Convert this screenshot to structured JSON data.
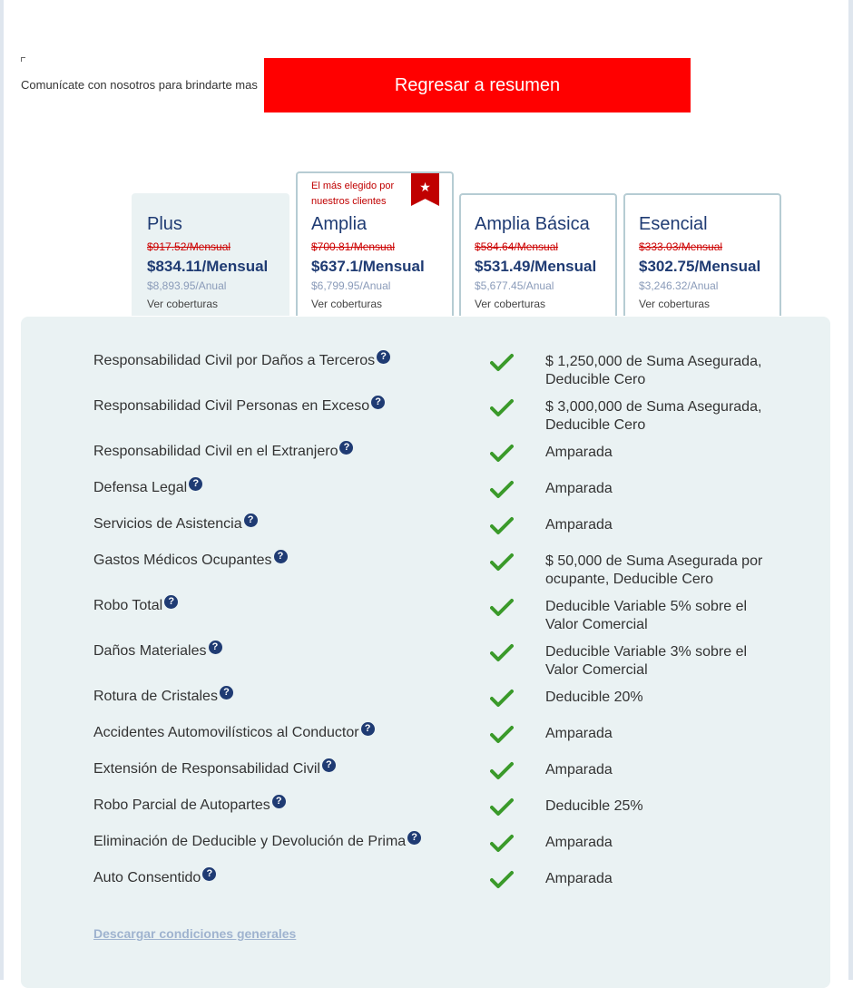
{
  "header": {
    "contact_text": "Comunícate con nosotros para brindarte mas",
    "back_button": "Regresar a resumen"
  },
  "plans": [
    {
      "name": "Plus",
      "old_price": "$917.52/Mensual",
      "price": "$834.11/Mensual",
      "annual": "$8,893.95/Anual",
      "coverage_link": "Ver coberturas"
    },
    {
      "name": "Amplia",
      "badge": "El más elegido por nuestros clientes",
      "badge_icon": "star-icon",
      "old_price": "$700.81/Mensual",
      "price": "$637.1/Mensual",
      "annual": "$6,799.95/Anual",
      "coverage_link": "Ver coberturas"
    },
    {
      "name": "Amplia Básica",
      "old_price": "$584.64/Mensual",
      "price": "$531.49/Mensual",
      "annual": "$5,677.45/Anual",
      "coverage_link": "Ver coberturas"
    },
    {
      "name": "Esencial",
      "old_price": "$333.03/Mensual",
      "price": "$302.75/Mensual",
      "annual": "$3,246.32/Anual",
      "coverage_link": "Ver coberturas"
    }
  ],
  "coverages": [
    {
      "name": "Responsabilidad Civil por Daños a Terceros",
      "value": "$ 1,250,000 de Suma Asegurada, Deducible Cero"
    },
    {
      "name": "Responsabilidad Civil Personas en Exceso",
      "value": "$ 3,000,000 de Suma Asegurada, Deducible Cero"
    },
    {
      "name": "Responsabilidad Civil en el Extranjero",
      "value": "Amparada"
    },
    {
      "name": "Defensa Legal",
      "value": "Amparada"
    },
    {
      "name": "Servicios de Asistencia",
      "value": "Amparada"
    },
    {
      "name": "Gastos Médicos Ocupantes",
      "value": "$ 50,000 de Suma Asegurada por ocupante, Deducible Cero"
    },
    {
      "name": "Robo Total",
      "value": "Deducible Variable 5% sobre el Valor Comercial"
    },
    {
      "name": "Daños Materiales",
      "value": "Deducible Variable 3% sobre el Valor Comercial"
    },
    {
      "name": "Rotura de Cristales",
      "value": "Deducible 20%"
    },
    {
      "name": "Accidentes Automovilísticos al Conductor",
      "value": "Amparada"
    },
    {
      "name": "Extensión de Responsabilidad Civil",
      "value": "Amparada"
    },
    {
      "name": "Robo Parcial de Autopartes",
      "value": "Deducible 25%"
    },
    {
      "name": "Eliminación de Deducible y Devolución de Prima",
      "value": "Amparada"
    },
    {
      "name": "Auto Consentido",
      "value": "Amparada"
    }
  ],
  "download_link": "Descargar condiciones generales",
  "icons": {
    "help": "question-circle-icon",
    "check": "check-icon",
    "help_glyph": "?",
    "star_glyph": "★"
  },
  "colors": {
    "accent_red": "#ff0000",
    "navy": "#1f3b73",
    "check_green": "#3a9a2a",
    "panel_bg": "#eaf2f3"
  }
}
